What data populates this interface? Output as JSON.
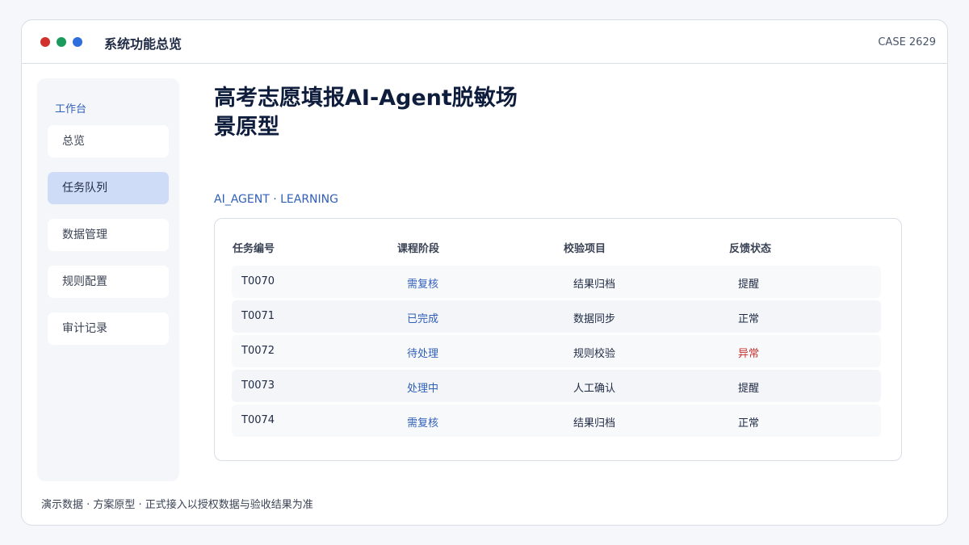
{
  "window": {
    "title": "系统功能总览",
    "case_id": "CASE 2629",
    "dots": {
      "red": "#d0312d",
      "green": "#1a9a5c",
      "blue": "#2f6fdd"
    }
  },
  "sidebar": {
    "group_label": "工作台",
    "items": [
      {
        "label": "总览",
        "active": false
      },
      {
        "label": "任务队列",
        "active": true
      },
      {
        "label": "数据管理",
        "active": false
      },
      {
        "label": "规则配置",
        "active": false
      },
      {
        "label": "审计记录",
        "active": false
      }
    ]
  },
  "main": {
    "title": "高考志愿填报AI-Agent脱敏场景原型",
    "subtitle": "AI_AGENT · LEARNING"
  },
  "table": {
    "headers": [
      "任务编号",
      "课程阶段",
      "校验项目",
      "反馈状态"
    ],
    "rows": [
      {
        "id": "T0070",
        "stage": "需复核",
        "check": "结果归档",
        "feedback": "提醒"
      },
      {
        "id": "T0071",
        "stage": "已完成",
        "check": "数据同步",
        "feedback": "正常"
      },
      {
        "id": "T0072",
        "stage": "待处理",
        "check": "规则校验",
        "feedback": "异常"
      },
      {
        "id": "T0073",
        "stage": "处理中",
        "check": "人工确认",
        "feedback": "提醒"
      },
      {
        "id": "T0074",
        "stage": "需复核",
        "check": "结果归档",
        "feedback": "正常"
      }
    ]
  },
  "footer": {
    "note": "演示数据 · 方案原型 · 正式接入以授权数据与验收结果为准"
  }
}
